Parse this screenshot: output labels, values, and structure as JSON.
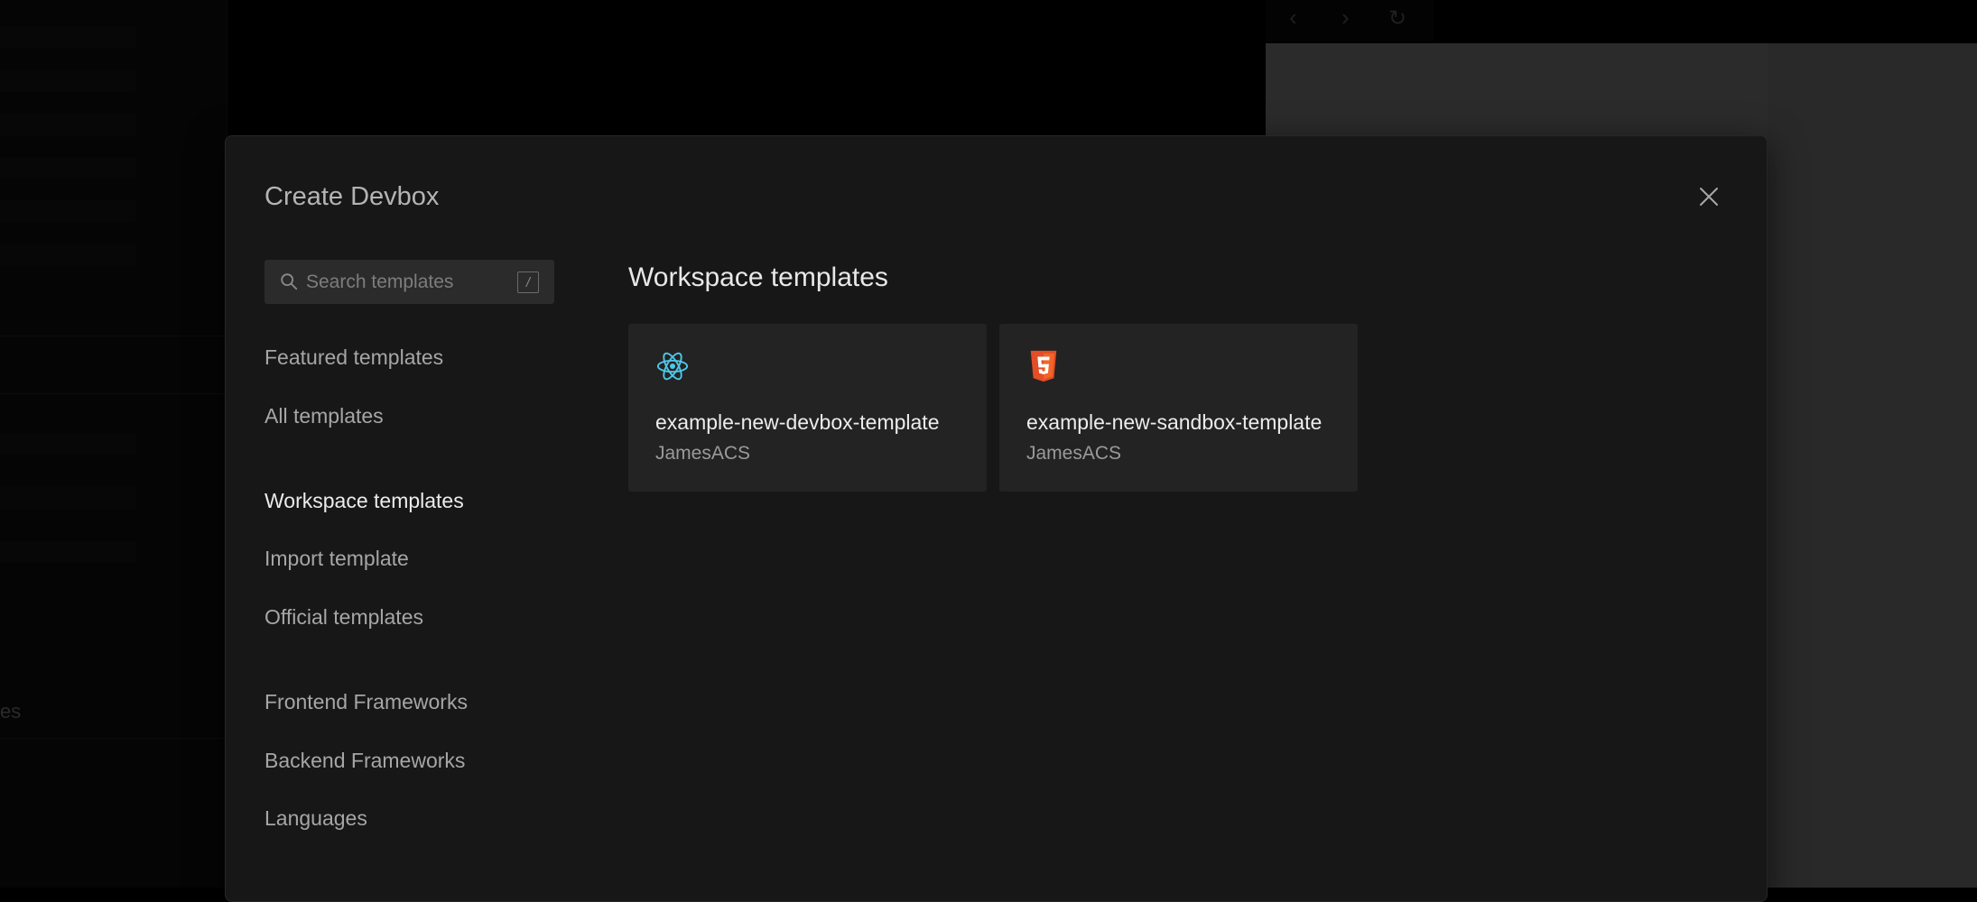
{
  "background": {
    "sidebar_fragment": "es"
  },
  "modal": {
    "title": "Create Devbox",
    "search": {
      "placeholder": "Search templates",
      "shortcut": "/"
    },
    "nav": {
      "featured": "Featured templates",
      "all": "All templates",
      "workspace": "Workspace templates",
      "import": "Import template",
      "official": "Official templates",
      "frontend": "Frontend Frameworks",
      "backend": "Backend Frameworks",
      "languages": "Languages"
    },
    "section_title": "Workspace templates",
    "cards": [
      {
        "name": "example-new-devbox-template",
        "author": "JamesACS",
        "icon": "react-icon"
      },
      {
        "name": "example-new-sandbox-template",
        "author": "JamesACS",
        "icon": "html5-icon"
      }
    ]
  },
  "colors": {
    "modal_bg": "#171717",
    "react": "#4fc7e8",
    "html5": "#e44d26"
  }
}
